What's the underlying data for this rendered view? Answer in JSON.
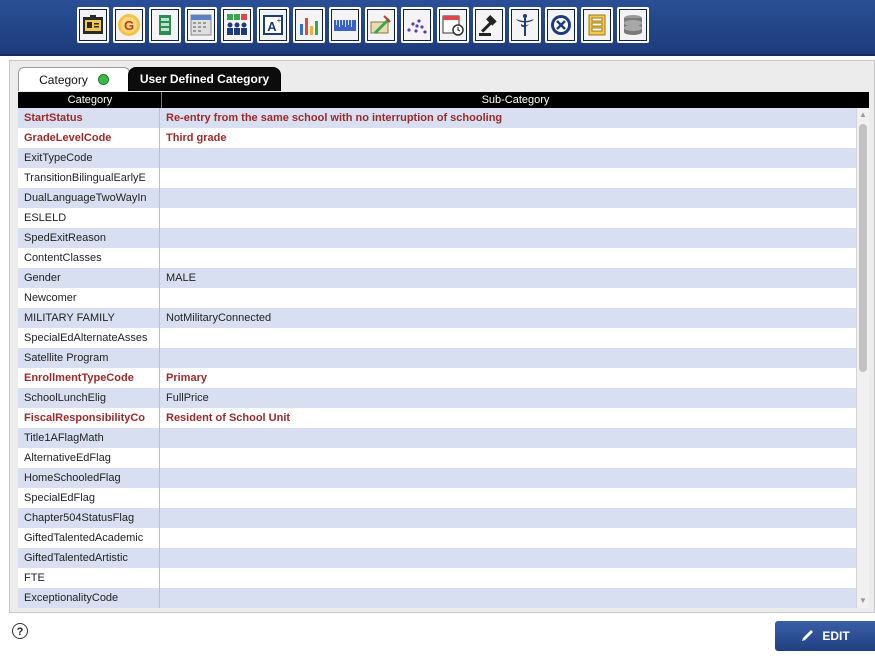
{
  "toolbar": {
    "icons": [
      "student-card-icon",
      "grade-g-icon",
      "book-icon",
      "calendar-icon",
      "attendance-icon",
      "grade-a-plus-icon",
      "bar-chart-icon",
      "ruler-icon",
      "graduation-icon",
      "scatter-icon",
      "schedule-icon",
      "discipline-gavel-icon",
      "health-caduceus-icon",
      "settings-gear-icon",
      "file-cabinet-icon",
      "database-icon"
    ]
  },
  "tabs": {
    "category": "Category",
    "user_defined": "User Defined Category"
  },
  "table": {
    "headers": {
      "category": "Category",
      "subcategory": "Sub-Category"
    },
    "rows": [
      {
        "category": "StartStatus",
        "sub": "Re-entry from the same school with no interruption of schooling",
        "highlight": true
      },
      {
        "category": "GradeLevelCode",
        "sub": "Third grade",
        "highlight": true
      },
      {
        "category": "ExitTypeCode",
        "sub": "",
        "highlight": false
      },
      {
        "category": "TransitionBilingualEarlyE",
        "sub": "",
        "highlight": false
      },
      {
        "category": "DualLanguageTwoWayIn",
        "sub": "",
        "highlight": false
      },
      {
        "category": "ESLELD",
        "sub": "",
        "highlight": false
      },
      {
        "category": "SpedExitReason",
        "sub": "",
        "highlight": false
      },
      {
        "category": "ContentClasses",
        "sub": "",
        "highlight": false
      },
      {
        "category": "Gender",
        "sub": "MALE",
        "highlight": false
      },
      {
        "category": "Newcomer",
        "sub": "",
        "highlight": false
      },
      {
        "category": "MILITARY FAMILY",
        "sub": "NotMilitaryConnected",
        "highlight": false
      },
      {
        "category": "SpecialEdAlternateAsses",
        "sub": "",
        "highlight": false
      },
      {
        "category": "Satellite Program",
        "sub": "",
        "highlight": false
      },
      {
        "category": "EnrollmentTypeCode",
        "sub": "Primary",
        "highlight": true
      },
      {
        "category": "SchoolLunchElig",
        "sub": "FullPrice",
        "highlight": false
      },
      {
        "category": "FiscalResponsibilityCo",
        "sub": "Resident of School Unit",
        "highlight": true
      },
      {
        "category": "Title1AFlagMath",
        "sub": "",
        "highlight": false
      },
      {
        "category": "AlternativeEdFlag",
        "sub": "",
        "highlight": false
      },
      {
        "category": "HomeSchooledFlag",
        "sub": "",
        "highlight": false
      },
      {
        "category": "SpecialEdFlag",
        "sub": "",
        "highlight": false
      },
      {
        "category": "Chapter504StatusFlag",
        "sub": "",
        "highlight": false
      },
      {
        "category": "GiftedTalentedAcademic",
        "sub": "",
        "highlight": false
      },
      {
        "category": "GiftedTalentedArtistic",
        "sub": "",
        "highlight": false
      },
      {
        "category": "FTE",
        "sub": "",
        "highlight": false
      },
      {
        "category": "ExceptionalityCode",
        "sub": "",
        "highlight": false
      }
    ]
  },
  "footer": {
    "help": "?",
    "edit_label": "EDIT"
  },
  "colors": {
    "toolbar": "#1d3b7a",
    "highlight_text": "#9d2a2a",
    "row_alt": "#d7dff1",
    "status_dot": "#3fb84a"
  }
}
